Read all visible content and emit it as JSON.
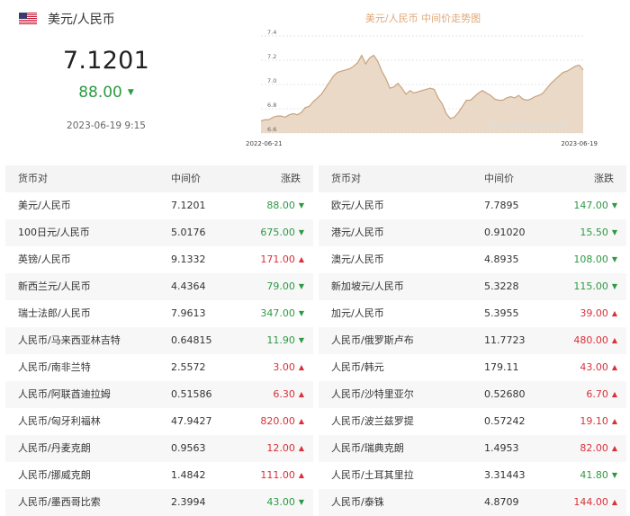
{
  "header": {
    "pair": "美元/人民币",
    "rate": "7.1201",
    "change": "88.00",
    "direction": "down",
    "timestamp": "2023-06-19 9:15",
    "colors": {
      "down": "#2d9a43",
      "up": "#d9303a"
    }
  },
  "chart_data": {
    "type": "area",
    "title": "美元/人民币 中间价走势图",
    "watermark": "chinamoney.com.cn",
    "x_start_label": "2022-06-21",
    "x_end_label": "2023-06-19",
    "y_ticks": [
      "7.4",
      "7.2",
      "7.0",
      "6.8",
      "6.6"
    ],
    "ylim": [
      6.6,
      7.4
    ],
    "values": [
      6.7,
      6.71,
      6.71,
      6.73,
      6.74,
      6.74,
      6.73,
      6.75,
      6.76,
      6.75,
      6.77,
      6.81,
      6.82,
      6.86,
      6.89,
      6.92,
      6.97,
      7.02,
      7.07,
      7.1,
      7.11,
      7.12,
      7.13,
      7.15,
      7.18,
      7.24,
      7.17,
      7.22,
      7.24,
      7.19,
      7.11,
      7.05,
      6.97,
      6.98,
      7.01,
      6.97,
      6.92,
      6.95,
      6.93,
      6.94,
      6.95,
      6.96,
      6.97,
      6.96,
      6.89,
      6.84,
      6.76,
      6.72,
      6.73,
      6.77,
      6.82,
      6.87,
      6.87,
      6.9,
      6.93,
      6.95,
      6.93,
      6.91,
      6.88,
      6.87,
      6.87,
      6.89,
      6.9,
      6.89,
      6.91,
      6.88,
      6.87,
      6.88,
      6.9,
      6.91,
      6.93,
      6.97,
      7.01,
      7.04,
      7.07,
      7.1,
      7.11,
      7.13,
      7.15,
      7.16,
      7.12
    ]
  },
  "table_headers": {
    "pair": "货币对",
    "mid": "中间价",
    "change": "涨跌"
  },
  "left_rows": [
    {
      "pair": "美元/人民币",
      "mid": "7.1201",
      "change": "88.00",
      "dir": "down"
    },
    {
      "pair": "100日元/人民币",
      "mid": "5.0176",
      "change": "675.00",
      "dir": "down"
    },
    {
      "pair": "英镑/人民币",
      "mid": "9.1332",
      "change": "171.00",
      "dir": "up"
    },
    {
      "pair": "新西兰元/人民币",
      "mid": "4.4364",
      "change": "79.00",
      "dir": "down"
    },
    {
      "pair": "瑞士法郎/人民币",
      "mid": "7.9613",
      "change": "347.00",
      "dir": "down"
    },
    {
      "pair": "人民币/马来西亚林吉特",
      "mid": "0.64815",
      "change": "11.90",
      "dir": "down"
    },
    {
      "pair": "人民币/南非兰特",
      "mid": "2.5572",
      "change": "3.00",
      "dir": "up"
    },
    {
      "pair": "人民币/阿联酋迪拉姆",
      "mid": "0.51586",
      "change": "6.30",
      "dir": "up"
    },
    {
      "pair": "人民币/匈牙利福林",
      "mid": "47.9427",
      "change": "820.00",
      "dir": "up"
    },
    {
      "pair": "人民币/丹麦克朗",
      "mid": "0.9563",
      "change": "12.00",
      "dir": "up"
    },
    {
      "pair": "人民币/挪威克朗",
      "mid": "1.4842",
      "change": "111.00",
      "dir": "up"
    },
    {
      "pair": "人民币/墨西哥比索",
      "mid": "2.3994",
      "change": "43.00",
      "dir": "down"
    }
  ],
  "right_rows": [
    {
      "pair": "欧元/人民币",
      "mid": "7.7895",
      "change": "147.00",
      "dir": "down"
    },
    {
      "pair": "港元/人民币",
      "mid": "0.91020",
      "change": "15.50",
      "dir": "down"
    },
    {
      "pair": "澳元/人民币",
      "mid": "4.8935",
      "change": "108.00",
      "dir": "down"
    },
    {
      "pair": "新加坡元/人民币",
      "mid": "5.3228",
      "change": "115.00",
      "dir": "down"
    },
    {
      "pair": "加元/人民币",
      "mid": "5.3955",
      "change": "39.00",
      "dir": "up"
    },
    {
      "pair": "人民币/俄罗斯卢布",
      "mid": "11.7723",
      "change": "480.00",
      "dir": "up"
    },
    {
      "pair": "人民币/韩元",
      "mid": "179.11",
      "change": "43.00",
      "dir": "up"
    },
    {
      "pair": "人民币/沙特里亚尔",
      "mid": "0.52680",
      "change": "6.70",
      "dir": "up"
    },
    {
      "pair": "人民币/波兰兹罗提",
      "mid": "0.57242",
      "change": "19.10",
      "dir": "up"
    },
    {
      "pair": "人民币/瑞典克朗",
      "mid": "1.4953",
      "change": "82.00",
      "dir": "up"
    },
    {
      "pair": "人民币/土耳其里拉",
      "mid": "3.31443",
      "change": "41.80",
      "dir": "down"
    },
    {
      "pair": "人民币/泰铢",
      "mid": "4.8709",
      "change": "144.00",
      "dir": "up"
    }
  ]
}
